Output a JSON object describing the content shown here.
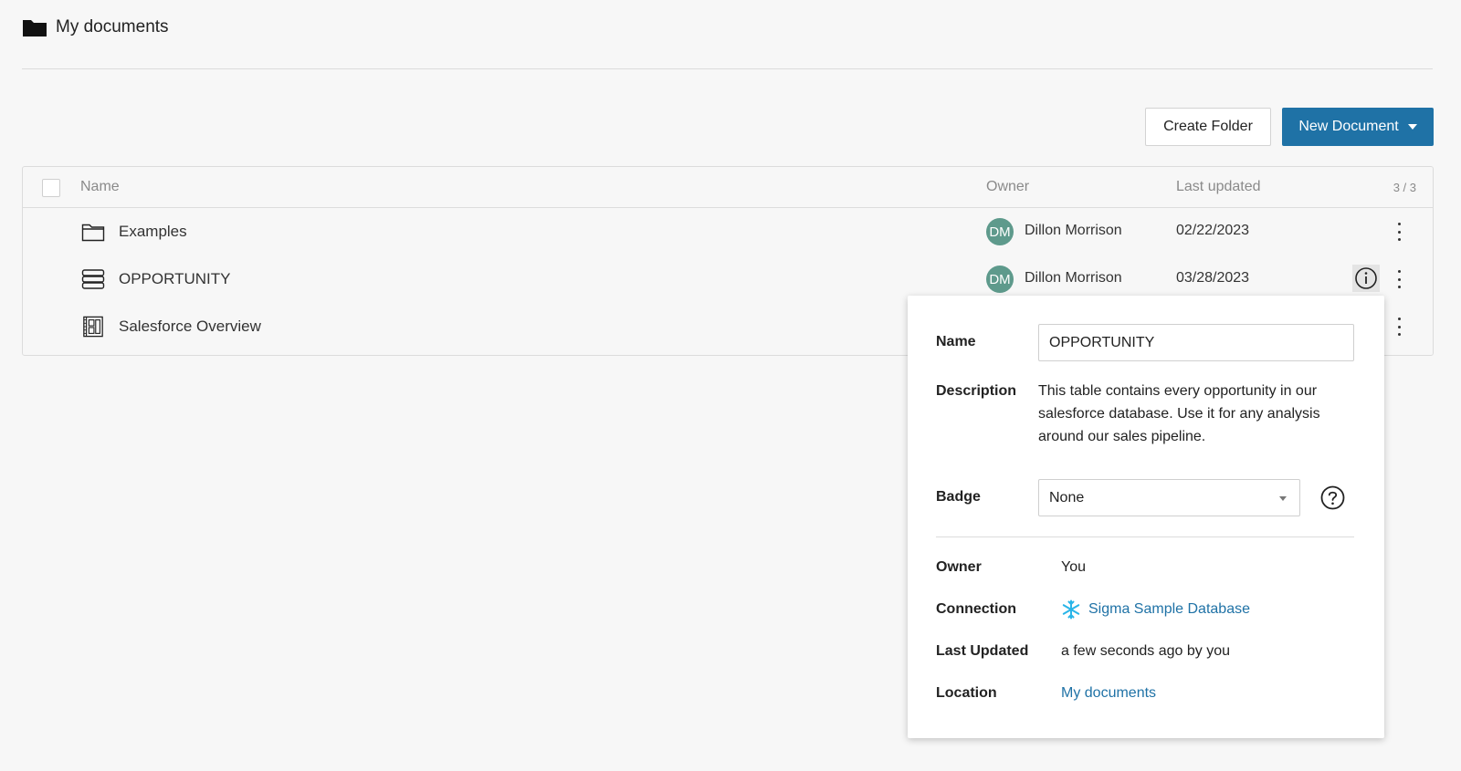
{
  "header": {
    "title": "My documents",
    "icon": "folder-icon"
  },
  "toolbar": {
    "create_folder_label": "Create Folder",
    "new_document_label": "New Document"
  },
  "table": {
    "columns": {
      "name": "Name",
      "owner": "Owner",
      "last_updated": "Last updated"
    },
    "count": "3 / 3",
    "rows": [
      {
        "name": "Examples",
        "icon": "folder-icon",
        "owner_initials": "DM",
        "owner": "Dillon Morrison",
        "last_updated": "02/22/2023"
      },
      {
        "name": "OPPORTUNITY",
        "icon": "table-icon",
        "owner_initials": "DM",
        "owner": "Dillon Morrison",
        "last_updated": "03/28/2023"
      },
      {
        "name": "Salesforce Overview",
        "icon": "workbook-icon"
      }
    ]
  },
  "popover": {
    "name_label": "Name",
    "name_value": "OPPORTUNITY",
    "description_label": "Description",
    "description_value": "This table contains every opportunity in our salesforce database. Use it for any analysis around our sales pipeline.",
    "badge_label": "Badge",
    "badge_value": "None",
    "owner_label": "Owner",
    "owner_value": "You",
    "connection_label": "Connection",
    "connection_value": "Sigma Sample Database",
    "last_updated_label": "Last Updated",
    "last_updated_value": "a few seconds ago by you",
    "location_label": "Location",
    "location_value": "My documents"
  },
  "colors": {
    "accent": "#1f72a6",
    "avatar": "#5e9a8c",
    "snowflake": "#29b5e8",
    "background": "#f7f7f7"
  }
}
